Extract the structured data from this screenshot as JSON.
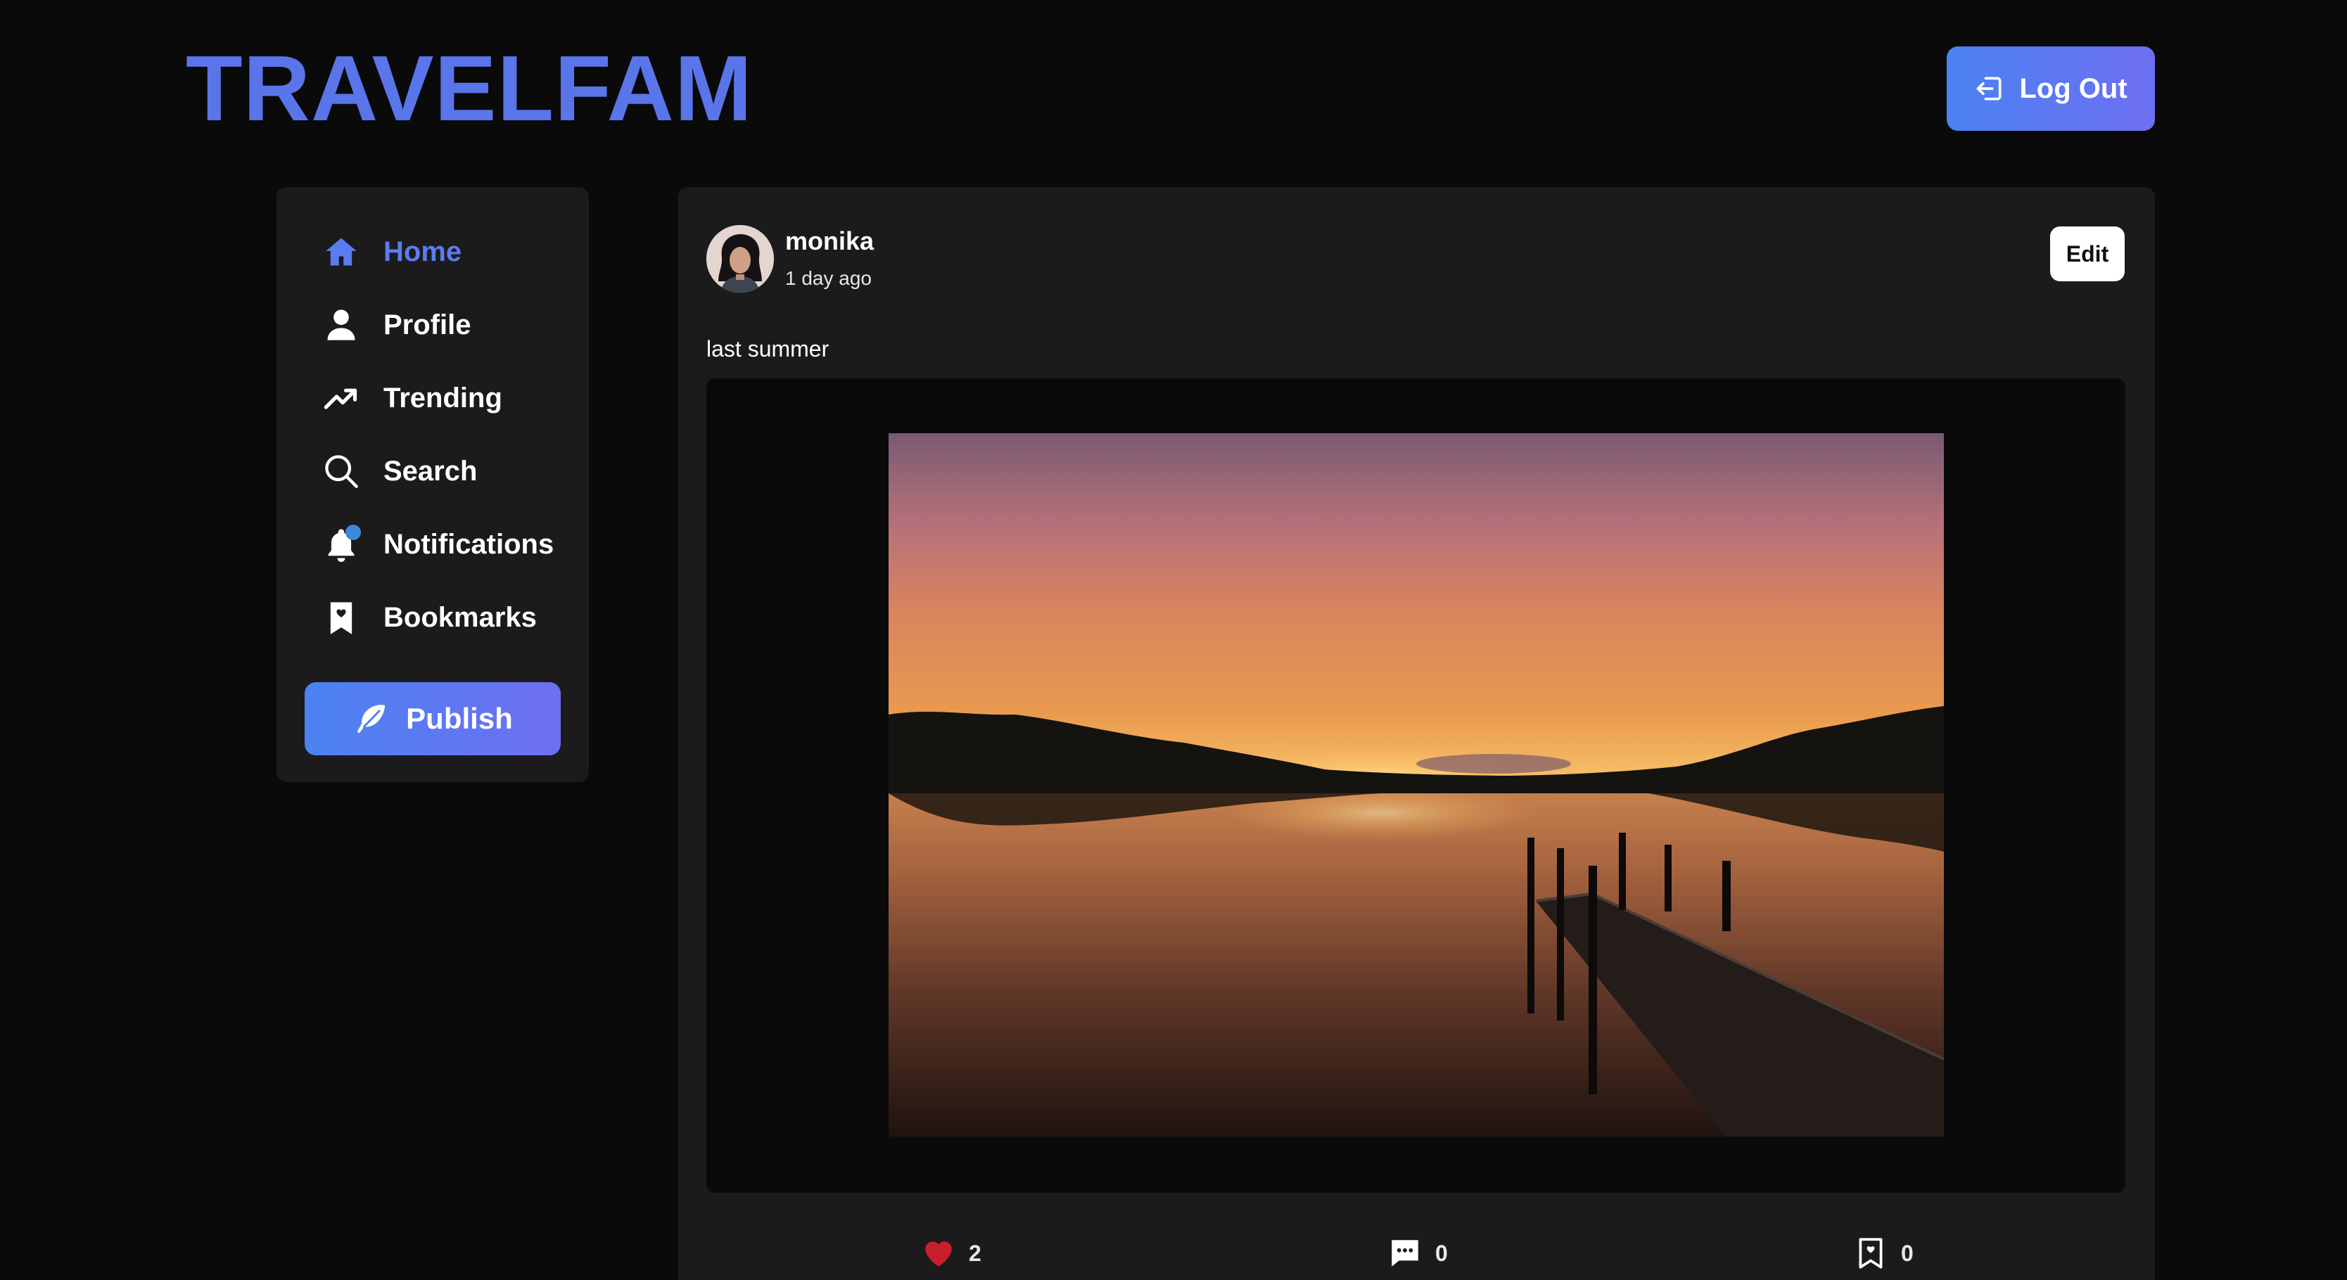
{
  "header": {
    "logo": "TRAVELFAM",
    "logout_label": "Log Out"
  },
  "sidebar": {
    "items": [
      {
        "label": "Home",
        "icon": "home-icon",
        "active": true
      },
      {
        "label": "Profile",
        "icon": "user-icon"
      },
      {
        "label": "Trending",
        "icon": "trending-icon"
      },
      {
        "label": "Search",
        "icon": "search-icon"
      },
      {
        "label": "Notifications",
        "icon": "bell-icon",
        "unread_dot": true
      },
      {
        "label": "Bookmarks",
        "icon": "bookmark-icon"
      }
    ],
    "publish_label": "Publish"
  },
  "post": {
    "username": "monika",
    "timestamp": "1 day ago",
    "edit_label": "Edit",
    "caption": "last summer",
    "likes": "2",
    "comments": "0",
    "bookmarks": "0"
  },
  "colors": {
    "accent": "#5a75ea",
    "button_gradient_start": "#4b82f2",
    "button_gradient_end": "#6e6ff2",
    "background": "#0a0a0b",
    "card": "#1b1b1c",
    "like": "#c8202a"
  }
}
